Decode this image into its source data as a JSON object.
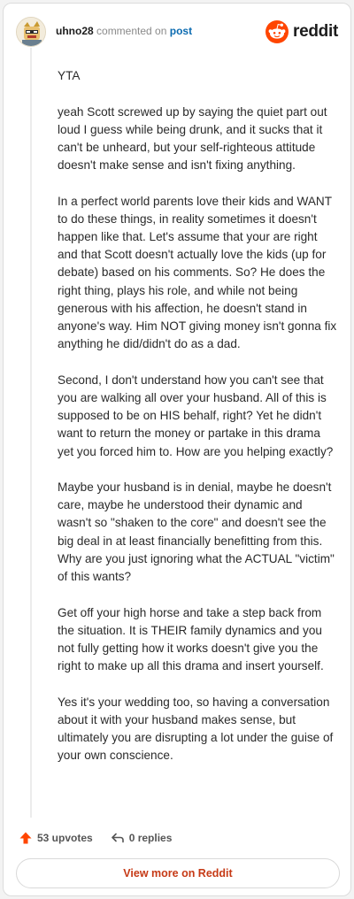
{
  "header": {
    "username": "uhno28",
    "action": "commented on",
    "post_link": "post",
    "brand": "reddit"
  },
  "comment": {
    "paragraphs": [
      "YTA",
      "yeah Scott screwed up by saying the quiet part out loud I guess while being drunk, and it sucks that it can't be unheard, but your self-righteous attitude doesn't make sense and isn't fixing anything.",
      "In a perfect world parents love their kids and WANT to do these things, in reality sometimes it doesn't happen like that. Let's assume that your are right and that Scott doesn't actually love the kids (up for debate) based on his comments. So? He does the right thing, plays his role, and while not being generous with his affection, he doesn't stand in anyone's way. Him NOT giving money isn't gonna fix anything he did/didn't do as a dad.",
      "Second, I don't understand how you can't see that you are walking all over your husband. All of this is supposed to be on HIS behalf, right? Yet he didn't want to return the money or partake in this drama yet you forced him to. How are you helping exactly?",
      "Maybe your husband is in denial, maybe he doesn't care, maybe he understood their dynamic and wasn't so \"shaken to the core\" and doesn't see the big deal in at least financially benefitting from this. Why are you just ignoring what the ACTUAL \"victim\" of this wants?",
      "Get off your high horse and take a step back from the situation. It is THEIR family dynamics and you not fully getting how it works doesn't give you the right to make up all this drama and insert yourself.",
      "Yes it's your wedding too, so having a conversation about it with your husband makes sense, but ultimately you are disrupting a lot under the guise of your own conscience."
    ]
  },
  "footer": {
    "upvotes": "53 upvotes",
    "replies": "0 replies",
    "view_more": "View more on Reddit"
  },
  "icons": {
    "upvote": "upvote-arrow-icon",
    "reply": "reply-arrow-icon",
    "brand_logo": "reddit-snoo-icon",
    "avatar": "user-avatar"
  },
  "colors": {
    "brand_orange": "#ff4500",
    "upvote_orange": "#ff4500",
    "link_blue": "#0a6ab0",
    "view_more_text": "#c63a16"
  }
}
